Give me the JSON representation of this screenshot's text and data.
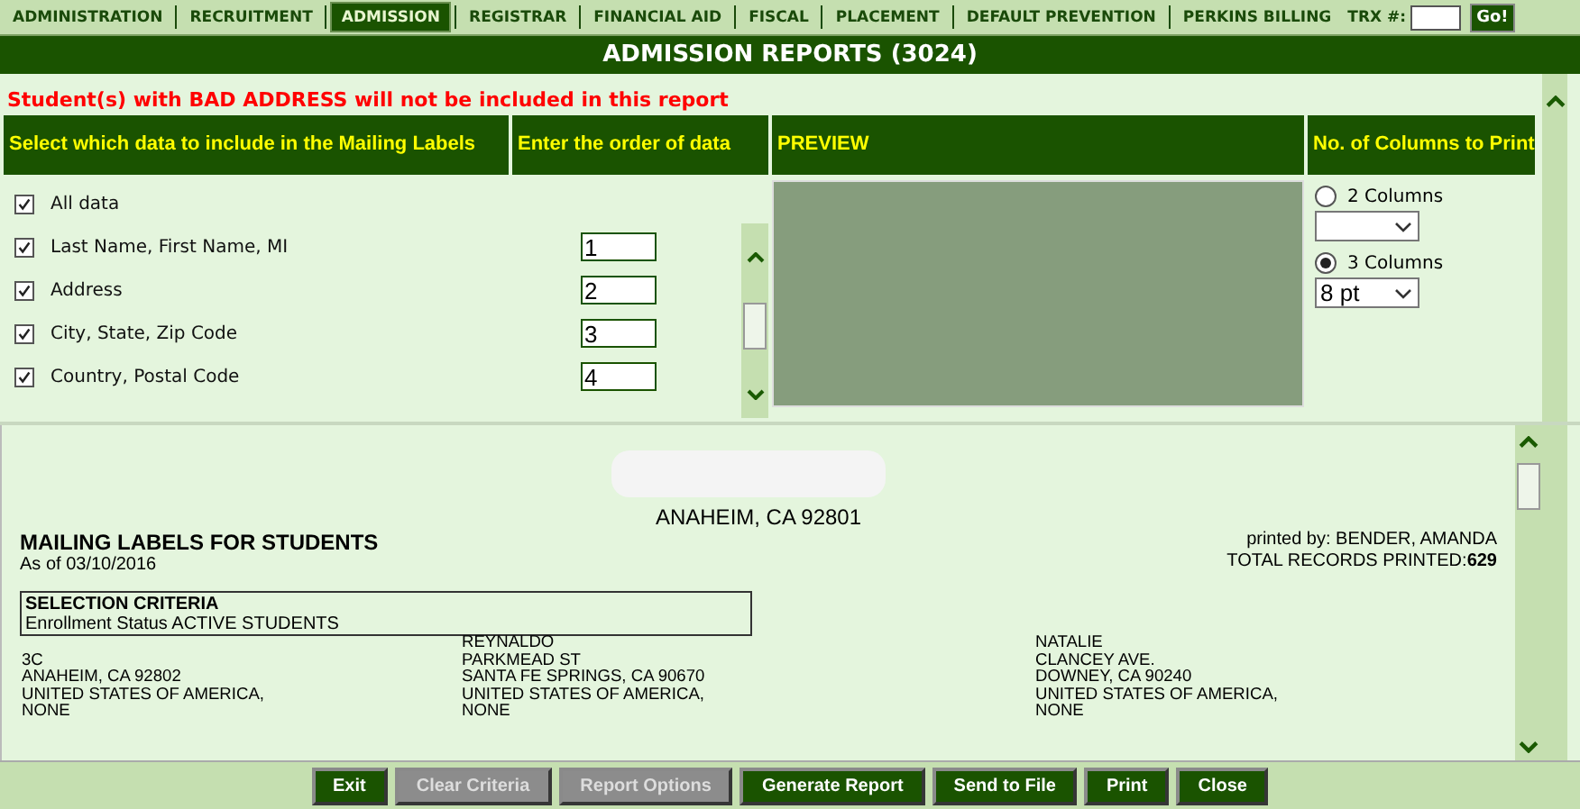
{
  "nav": {
    "tabs": [
      {
        "label": "ADMINISTRATION",
        "selected": false
      },
      {
        "label": "RECRUITMENT",
        "selected": false
      },
      {
        "label": "ADMISSION",
        "selected": true
      },
      {
        "label": "REGISTRAR",
        "selected": false
      },
      {
        "label": "FINANCIAL AID",
        "selected": false
      },
      {
        "label": "FISCAL",
        "selected": false
      },
      {
        "label": "PLACEMENT",
        "selected": false
      },
      {
        "label": "DEFAULT PREVENTION",
        "selected": false
      },
      {
        "label": "PERKINS BILLING",
        "selected": false
      }
    ],
    "trx_label": "TRX #:",
    "go_button": "Go!"
  },
  "title": "ADMISSION REPORTS (3024)",
  "warning": "Student(s) with BAD ADDRESS will not be included in this report",
  "columns": [
    "Select which data to include in the Mailing Labels",
    "Enter the order of data",
    "PREVIEW",
    "No. of Columns to Print"
  ],
  "fields": [
    {
      "label": "All data",
      "checked": true
    },
    {
      "label": "Last Name, First Name, MI",
      "checked": true,
      "order": "1"
    },
    {
      "label": "Address",
      "checked": true,
      "order": "2"
    },
    {
      "label": "City, State, Zip Code",
      "checked": true,
      "order": "3"
    },
    {
      "label": "Country, Postal Code",
      "checked": true,
      "order": "4"
    }
  ],
  "column_options": [
    {
      "label": "2 Columns",
      "selected": false
    },
    {
      "label": "3 Columns",
      "selected": true,
      "value": "8 pt"
    }
  ],
  "report": {
    "city": "ANAHEIM, CA 92801",
    "title": "MAILING LABELS FOR STUDENTS",
    "date": "As of 03/10/2016",
    "printed_by": "printed by: BENDER, AMANDA",
    "total": "TOTAL RECORDS PRINTED:**629**",
    "criteria_title": "SELECTION CRITERIA",
    "criteria": "Enrollment Status ACTIVE STUDENTS",
    "labels": [
      {
        "lines": [
          "3C",
          "ANAHEIM, CA 92802",
          "UNITED STATES OF AMERICA,",
          "NONE"
        ]
      },
      {
        "lines": [
          "REYNALDO",
          "PARKMEAD ST",
          "SANTA FE SPRINGS, CA 90670",
          "UNITED STATES OF AMERICA,",
          "NONE"
        ]
      },
      {
        "lines": [
          "NATALIE",
          "CLANCEY AVE.",
          "DOWNEY, CA 90240",
          "UNITED STATES OF AMERICA,",
          "NONE"
        ]
      }
    ]
  },
  "buttons": [
    {
      "label": "Exit",
      "disabled": false
    },
    {
      "label": "Clear Criteria",
      "disabled": true
    },
    {
      "label": "Report Options",
      "disabled": true
    },
    {
      "label": "Generate Report",
      "disabled": false
    },
    {
      "label": "Send to File",
      "disabled": false
    },
    {
      "label": "Print",
      "disabled": false
    },
    {
      "label": "Close",
      "disabled": false
    }
  ]
}
